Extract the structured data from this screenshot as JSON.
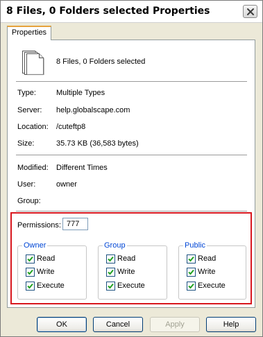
{
  "window": {
    "title": "8 Files, 0 Folders selected Properties"
  },
  "tabs": [
    {
      "label": "Properties",
      "active": true
    }
  ],
  "header": {
    "icon": "multiple-files-icon",
    "summary": "8 Files, 0 Folders selected"
  },
  "details": [
    {
      "label": "Type:",
      "value": "Multiple Types"
    },
    {
      "label": "Server:",
      "value": "help.globalscape.com"
    },
    {
      "label": "Location:",
      "value": "/cuteftp8"
    },
    {
      "label": "Size:",
      "value": "35.73 KB (36,583 bytes)"
    }
  ],
  "meta": [
    {
      "label": "Modified:",
      "value": "Different Times"
    },
    {
      "label": "User:",
      "value": "owner"
    },
    {
      "label": "Group:",
      "value": ""
    }
  ],
  "permissions": {
    "label": "Permissions:",
    "value": "777",
    "groups": [
      {
        "title": "Owner",
        "items": [
          {
            "label": "Read",
            "checked": true
          },
          {
            "label": "Write",
            "checked": true
          },
          {
            "label": "Execute",
            "checked": true
          }
        ]
      },
      {
        "title": "Group",
        "items": [
          {
            "label": "Read",
            "checked": true
          },
          {
            "label": "Write",
            "checked": true
          },
          {
            "label": "Execute",
            "checked": true
          }
        ]
      },
      {
        "title": "Public",
        "items": [
          {
            "label": "Read",
            "checked": true
          },
          {
            "label": "Write",
            "checked": true
          },
          {
            "label": "Execute",
            "checked": true
          }
        ]
      }
    ]
  },
  "buttons": {
    "ok": "OK",
    "cancel": "Cancel",
    "apply": "Apply",
    "help": "Help"
  },
  "colors": {
    "highlight_border": "#d8171e",
    "group_title": "#0046d5",
    "checkmark": "#21a121"
  }
}
